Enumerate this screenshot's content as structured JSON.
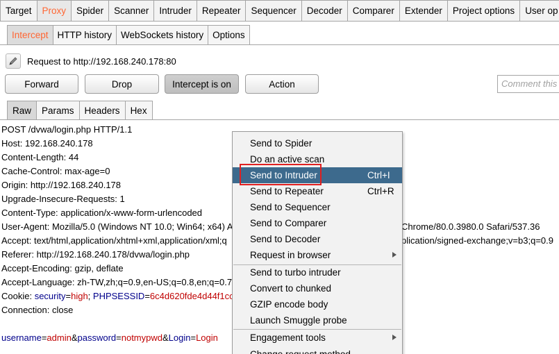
{
  "top_tabs": [
    "Target",
    "Proxy",
    "Spider",
    "Scanner",
    "Intruder",
    "Repeater",
    "Sequencer",
    "Decoder",
    "Comparer",
    "Extender",
    "Project options",
    "User op"
  ],
  "sub_tabs": [
    "Intercept",
    "HTTP history",
    "WebSockets history",
    "Options"
  ],
  "request_line": "Request to http://192.168.240.178:80",
  "buttons": {
    "forward": "Forward",
    "drop": "Drop",
    "intercept": "Intercept is on",
    "action": "Action"
  },
  "comment_placeholder": "Comment this",
  "editor_tabs": [
    "Raw",
    "Params",
    "Headers",
    "Hex"
  ],
  "request": {
    "lines": [
      "POST /dvwa/login.php HTTP/1.1",
      "Host: 192.168.240.178",
      "Content-Length: 44",
      "Cache-Control: max-age=0",
      "Origin: http://192.168.240.178",
      "Upgrade-Insecure-Requests: 1",
      "Content-Type: application/x-www-form-urlencoded"
    ],
    "ua_left": "User-Agent: Mozilla/5.0 (Windows NT 10.0; Win64; x64) A",
    "ua_right": "Chrome/80.0.3980.0 Safari/537.36",
    "accept_left": "Accept: text/html,application/xhtml+xml,application/xml;q",
    "accept_right": "plication/signed-exchange;v=b3;q=0.9",
    "referer": "Referer: http://192.168.240.178/dvwa/login.php",
    "encoding": "Accept-Encoding: gzip, deflate",
    "language": "Accept-Language: zh-TW,zh;q=0.9,en-US;q=0.8,en;q=0.7",
    "cookie": {
      "prefix": "Cookie: ",
      "k1": "security",
      "v1": "high",
      "sep": "; ",
      "k2": "PHPSESSID",
      "v2": "6c4d620fde4d44f1cc"
    },
    "connection": "Connection: close",
    "body": [
      {
        "k": "username",
        "v": "admin"
      },
      {
        "k": "password",
        "v": "notmypwd"
      },
      {
        "k": "Login",
        "v": "Login"
      }
    ]
  },
  "context_menu": {
    "items": [
      {
        "label": "Send to Spider",
        "shortcut": ""
      },
      {
        "label": "Do an active scan",
        "shortcut": ""
      },
      {
        "label": "Send to Intruder",
        "shortcut": "Ctrl+I"
      },
      {
        "label": "Send to Repeater",
        "shortcut": "Ctrl+R"
      },
      {
        "label": "Send to Sequencer",
        "shortcut": ""
      },
      {
        "label": "Send to Comparer",
        "shortcut": ""
      },
      {
        "label": "Send to Decoder",
        "shortcut": ""
      },
      {
        "label": "Request in browser",
        "shortcut": ""
      },
      {
        "label": "Send to turbo intruder",
        "shortcut": ""
      },
      {
        "label": "Convert to chunked",
        "shortcut": ""
      },
      {
        "label": "GZIP encode body",
        "shortcut": ""
      },
      {
        "label": "Launch Smuggle probe",
        "shortcut": ""
      },
      {
        "label": "Engagement tools",
        "shortcut": ""
      },
      {
        "label": "Change request method",
        "shortcut": ""
      }
    ]
  },
  "colors": {
    "accent": "#ff6633",
    "highlight": "#3d6a8d",
    "key": "#00008b",
    "value": "#c00000",
    "annotation": "#e02020"
  }
}
